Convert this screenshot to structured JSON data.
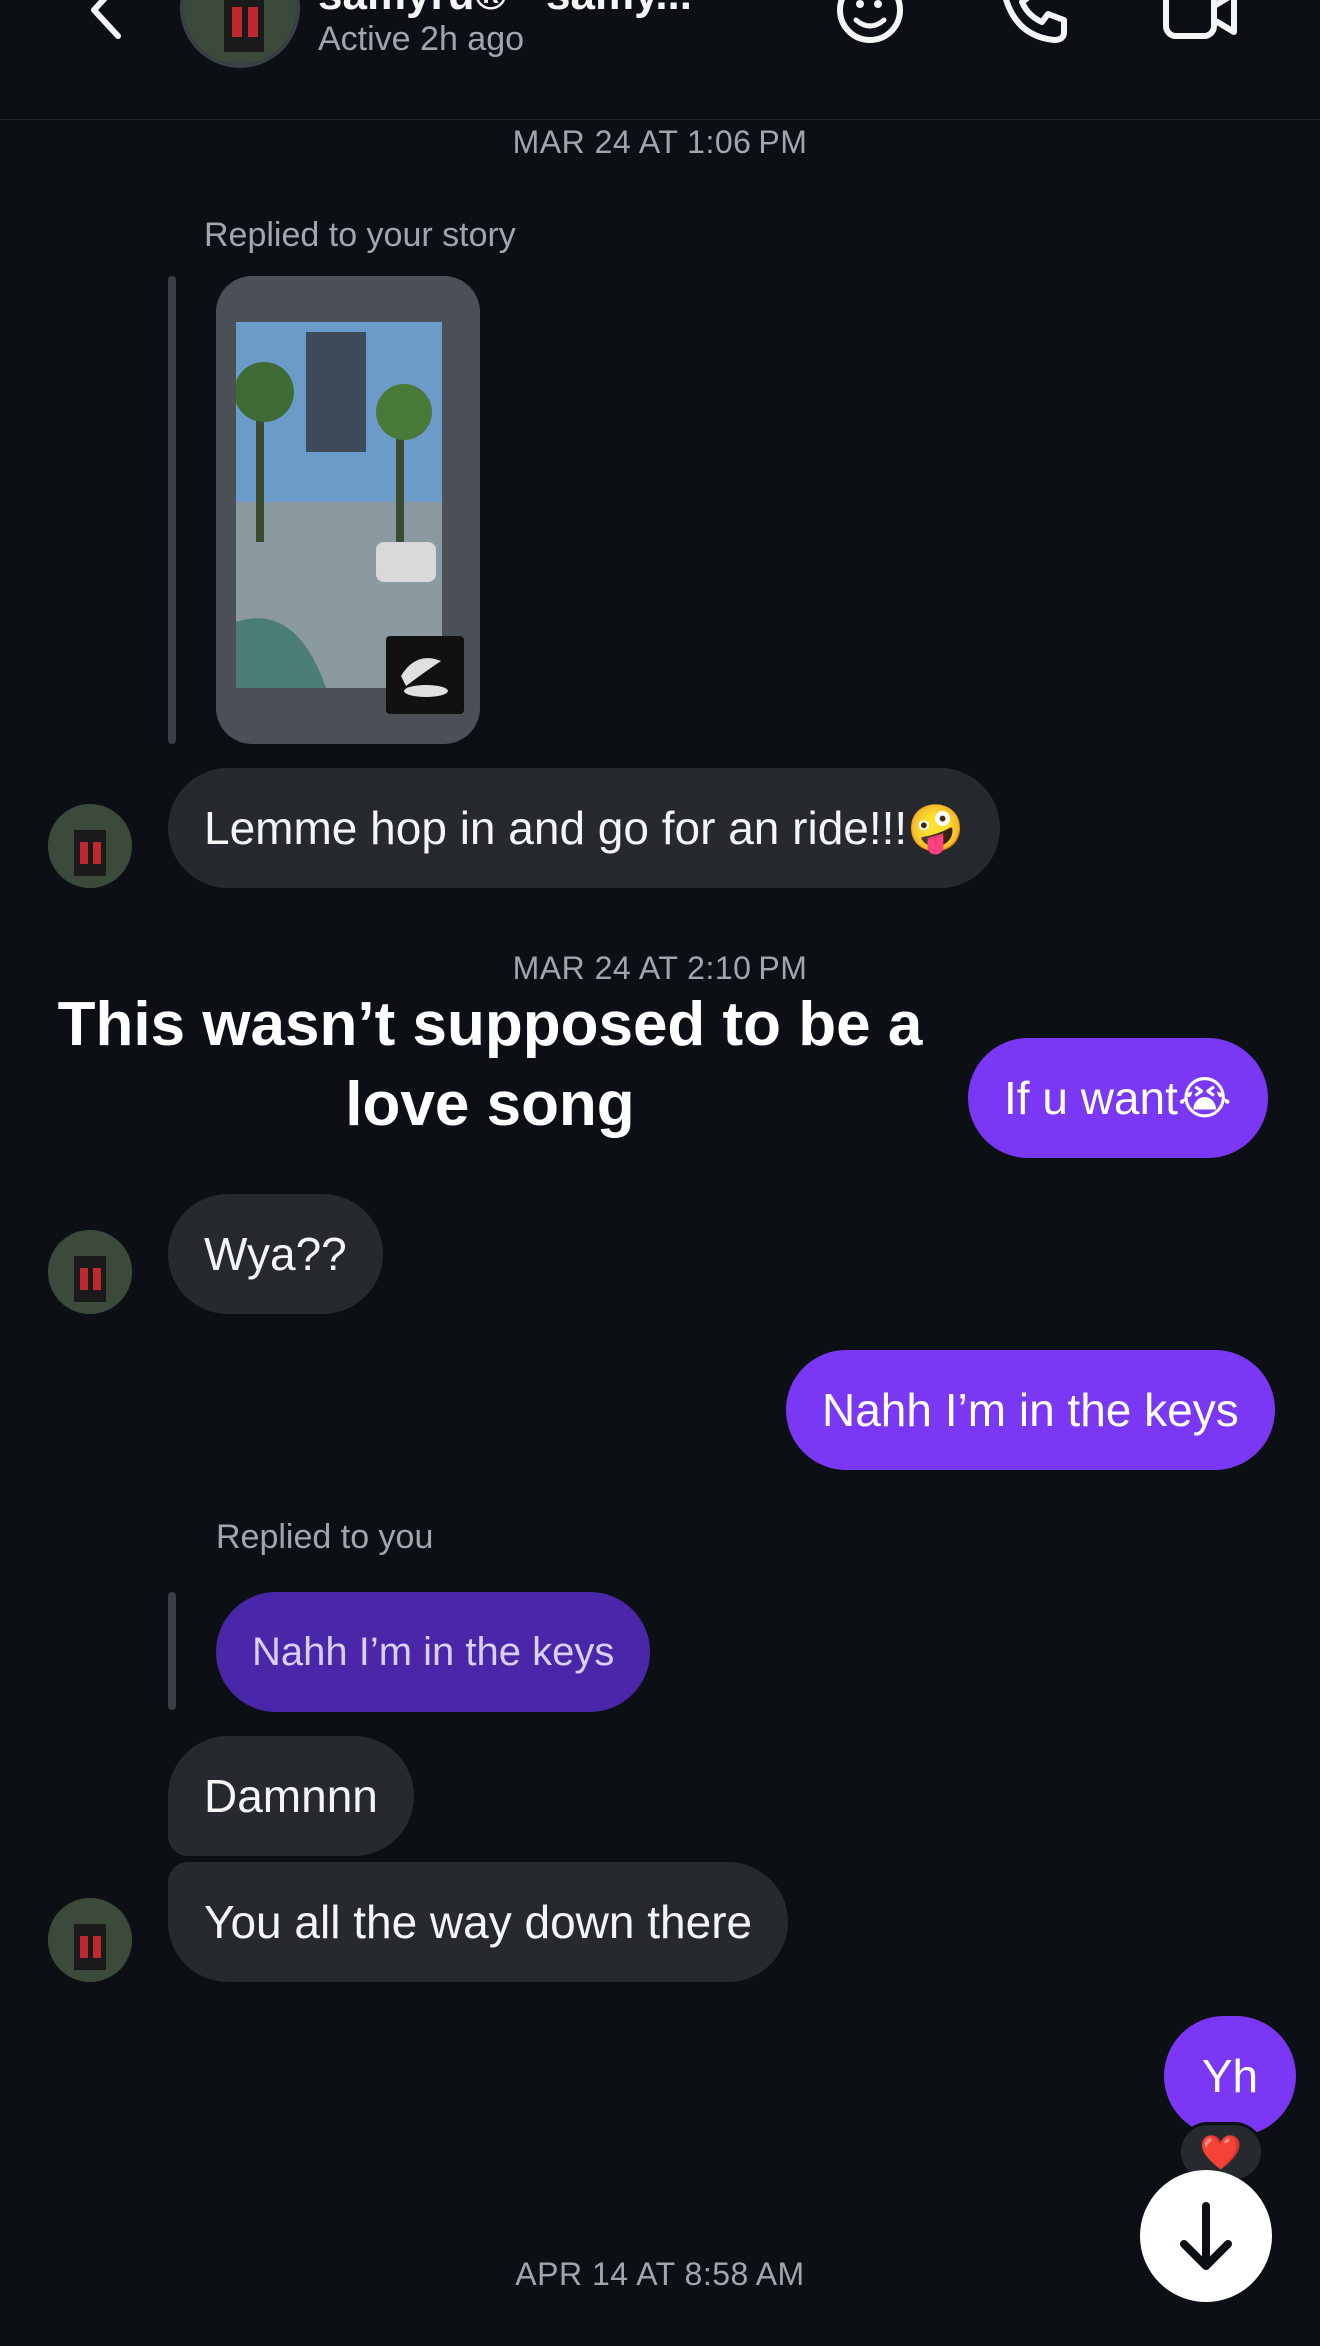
{
  "header": {
    "name": "samyru® · samy...",
    "status": "Active 2h ago"
  },
  "messages": {
    "ts1": "MAR 24 AT 1:06 PM",
    "replied_story_label": "Replied to your story",
    "msg_ride": "Lemme hop in and go for an ride!!!🤪",
    "ts2": "MAR 24 AT 2:10 PM",
    "overlay_line1": "This wasn’t supposed to be a",
    "overlay_line2": "love song",
    "msg_if_u_want": "If u want😭",
    "msg_wya": "Wya??",
    "msg_keys": "Nahh I’m in the keys",
    "replied_you_label": "Replied to you",
    "quoted_keys": "Nahh I’m in the keys",
    "msg_damn": "Damnnn",
    "msg_way_down": "You all the way down there",
    "msg_yh": "Yh",
    "reaction": "❤️",
    "ts3": "APR 14 AT 8:58 AM"
  },
  "icons": [
    "back-chevron-icon",
    "sticker-icon",
    "phone-icon",
    "video-icon",
    "arrow-down-icon"
  ]
}
